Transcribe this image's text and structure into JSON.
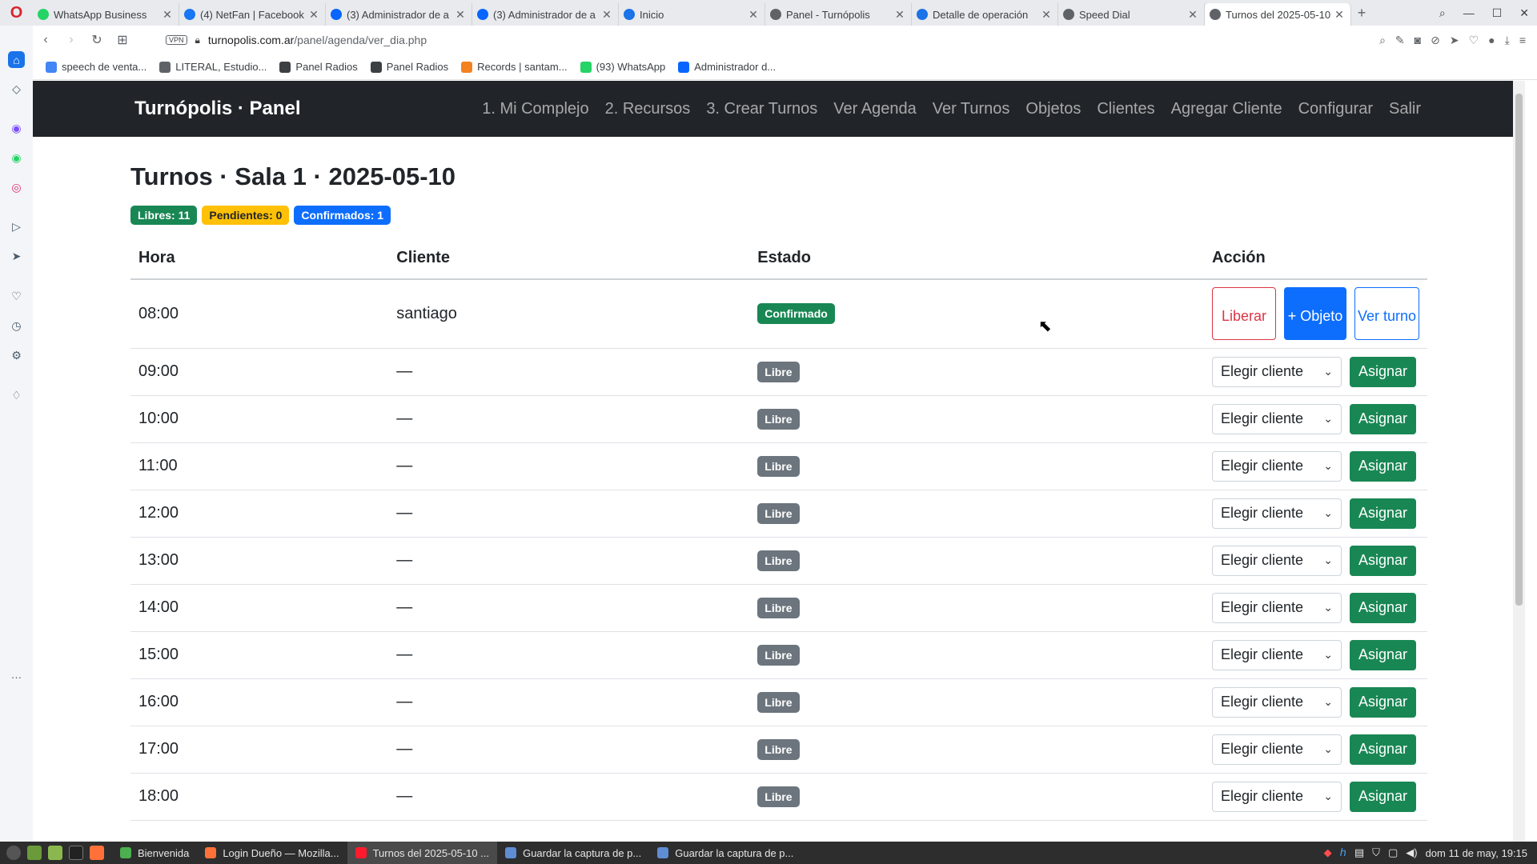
{
  "browser": {
    "tabs": [
      {
        "title": "WhatsApp Business",
        "icon": "whatsapp-icon",
        "color": "#25d366"
      },
      {
        "title": "(4) NetFan | Facebook",
        "icon": "facebook-icon",
        "color": "#1877f2"
      },
      {
        "title": "(3) Administrador de a",
        "icon": "meta-icon",
        "color": "#0866ff"
      },
      {
        "title": "(3) Administrador de a",
        "icon": "meta-icon",
        "color": "#0866ff"
      },
      {
        "title": "Inicio",
        "icon": "globe-icon",
        "color": "#1a73e8"
      },
      {
        "title": "Panel - Turnópolis",
        "icon": "globe-icon",
        "color": "#5f6368"
      },
      {
        "title": "Detalle de operación",
        "icon": "globe-icon",
        "color": "#1a73e8"
      },
      {
        "title": "Speed Dial",
        "icon": "grid-icon",
        "color": "#5f6368"
      },
      {
        "title": "Turnos del 2025-05-10",
        "icon": "globe-icon",
        "color": "#5f6368",
        "active": true
      }
    ],
    "url_host": "turnopolis.com.ar",
    "url_path": "/panel/agenda/ver_dia.php",
    "vpn_label": "VPN",
    "bookmarks": [
      {
        "label": "speech de venta...",
        "icon": "google-icon",
        "color": "#4285f4"
      },
      {
        "label": "LITERAL, Estudio...",
        "icon": "globe-icon",
        "color": "#5f6368"
      },
      {
        "label": "Panel Radios",
        "icon": "file-icon",
        "color": "#3c4043"
      },
      {
        "label": "Panel Radios",
        "icon": "file-icon",
        "color": "#3c4043"
      },
      {
        "label": "Records | santam...",
        "icon": "cloud-icon",
        "color": "#f48120"
      },
      {
        "label": "(93) WhatsApp",
        "icon": "whatsapp-icon",
        "color": "#25d366"
      },
      {
        "label": "Administrador d...",
        "icon": "meta-icon",
        "color": "#0866ff"
      }
    ]
  },
  "navbar": {
    "brand": "Turnópolis · Panel",
    "links": [
      "1. Mi Complejo",
      "2. Recursos",
      "3. Crear Turnos",
      "Ver Agenda",
      "Ver Turnos",
      "Objetos",
      "Clientes",
      "Agregar Cliente",
      "Configurar",
      "Salir"
    ]
  },
  "page": {
    "title": "Turnos · Sala 1 · 2025-05-10",
    "badges": {
      "libres": "Libres: 11",
      "pendientes": "Pendientes: 0",
      "confirmados": "Confirmados: 1"
    },
    "table": {
      "headers": {
        "hora": "Hora",
        "cliente": "Cliente",
        "estado": "Estado",
        "accion": "Acción"
      },
      "confirmed_row": {
        "hora": "08:00",
        "cliente": "santiago",
        "estado": "Confirmado",
        "liberar": "Liberar",
        "objeto": "+ Objeto",
        "ver": "Ver turno"
      },
      "free_rows": [
        {
          "hora": "09:00"
        },
        {
          "hora": "10:00"
        },
        {
          "hora": "11:00"
        },
        {
          "hora": "12:00"
        },
        {
          "hora": "13:00"
        },
        {
          "hora": "14:00"
        },
        {
          "hora": "15:00"
        },
        {
          "hora": "16:00"
        },
        {
          "hora": "17:00"
        },
        {
          "hora": "18:00"
        }
      ],
      "empty_client": "—",
      "free_status": "Libre",
      "select_placeholder": "Elegir cliente",
      "assign_label": "Asignar"
    }
  },
  "taskbar": {
    "items": [
      {
        "label": "Bienvenida",
        "color": "#4caf50"
      },
      {
        "label": "Login Dueño — Mozilla...",
        "color": "#ff7139"
      },
      {
        "label": "Turnos del 2025-05-10 ...",
        "color": "#ff1b2d",
        "active": true
      },
      {
        "label": "Guardar la captura de p...",
        "color": "#5f8dd3"
      },
      {
        "label": "Guardar la captura de p...",
        "color": "#5f8dd3"
      }
    ],
    "clock": "dom 11 de may, 19:15"
  }
}
